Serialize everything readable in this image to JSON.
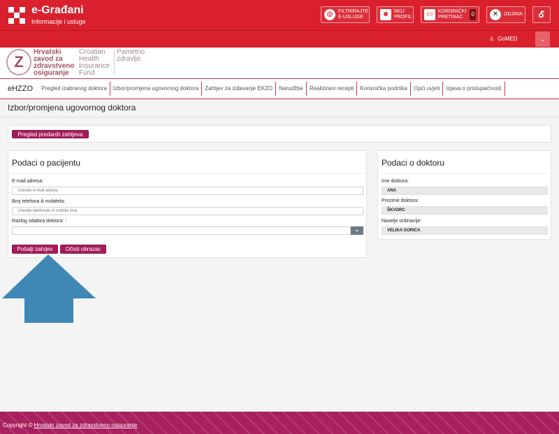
{
  "brand": {
    "title": "e-Građani",
    "subtitle": "Informacije i usluge"
  },
  "toolbar": {
    "filter_label_1": "FILTRIRAJTE",
    "filter_label_2": "E-USLUGE",
    "profile_label_1": "MOJ",
    "profile_label_2": "PROFIL",
    "inbox_label_1": "KORISNIČKI",
    "inbox_label_2": "PRETINAC",
    "inbox_count": "0",
    "logout_label": "ODJAVA"
  },
  "user": {
    "name": "GoMED"
  },
  "hzzo": {
    "hr_line1": "Hrvatski",
    "hr_line2": "zavod za",
    "hr_line3": "zdravstveno",
    "hr_line4": "osiguranje",
    "en_line1": "Croatian",
    "en_line2": "Health",
    "en_line3": "Insurance",
    "en_line4": "Fund",
    "tag_line1": "Pametno",
    "tag_line2": "zdravlje."
  },
  "nav": {
    "brand": "eHZZO",
    "items": [
      {
        "label": "Pregled izabranog doktora"
      },
      {
        "label": "Izbor/promjena ugovornog doktora"
      },
      {
        "label": "Zahtjev za izdavanje EKZO"
      },
      {
        "label": "Narudžbe"
      },
      {
        "label": "Realizirani recepti"
      },
      {
        "label": "Korisnička podrška"
      },
      {
        "label": "Opći uvjeti"
      },
      {
        "label": "Izjava o pristupačnosti"
      }
    ]
  },
  "page": {
    "title": "Izbor/promjena ugovornog doktora",
    "review_button": "Pregled predanih zahtjeva"
  },
  "patient": {
    "title": "Podaci o pacijentu",
    "email_label": "E-mail adresa:",
    "email_placeholder": "Unesite e-mail adresu",
    "phone_label": "Broj telefona ili mobitela:",
    "phone_placeholder": "Unesite telefonski ili mobilni broj",
    "reason_label": "Razlog odabira doktora: :",
    "reason_value": "",
    "submit_button": "Pošalji zahtjev",
    "clear_button": "Očisti obrazac"
  },
  "doctor": {
    "title": "Podaci o doktoru",
    "first_name_label": "Ime doktora:",
    "first_name_value": "ANA",
    "last_name_label": "Prezime doktora:",
    "last_name_value": "ŠKVORC",
    "town_label": "Naselje ordinacije:",
    "town_value": "VELIKA GORICA"
  },
  "footer": {
    "prefix": "Copyright © ",
    "link": "Hrvatski zavod za zdravstveno osiguranje"
  },
  "colors": {
    "red": "#d9202c",
    "purple": "#a61c5a",
    "arrow": "#3f87b5"
  }
}
